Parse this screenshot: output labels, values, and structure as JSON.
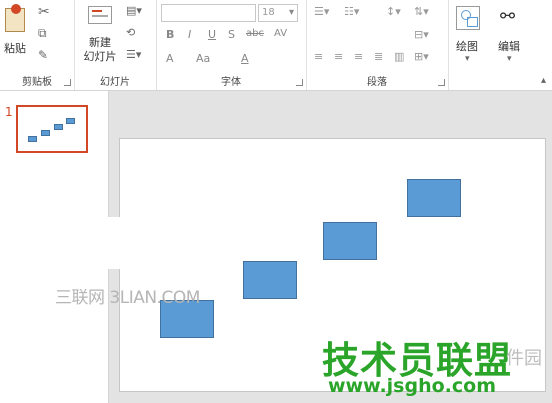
{
  "ribbon": {
    "clipboard": {
      "paste_label": "粘贴",
      "group_label": "剪贴板"
    },
    "slides": {
      "new_slide_label": "新建\n幻灯片",
      "group_label": "幻灯片"
    },
    "font": {
      "group_label": "字体",
      "size_value": "18",
      "bold": "B",
      "italic": "I",
      "underline": "U",
      "shadow": "S",
      "strike": "abc",
      "spacing": "AV",
      "grow": "A",
      "case": "Aa",
      "color": "A"
    },
    "paragraph": {
      "group_label": "段落"
    },
    "drawing": {
      "label": "绘图"
    },
    "editing": {
      "label": "编辑"
    }
  },
  "thumbnails": [
    {
      "number": "1"
    }
  ],
  "watermarks": {
    "left": "三联网 3LIAN.COM",
    "brand": "技术员联盟",
    "url": "www.jsgho.com",
    "partial": "件园"
  },
  "colors": {
    "shape_fill": "#5b9bd5",
    "shape_border": "#41719c",
    "thumb_selected": "#d24726",
    "watermark_green": "#2aa52a"
  }
}
